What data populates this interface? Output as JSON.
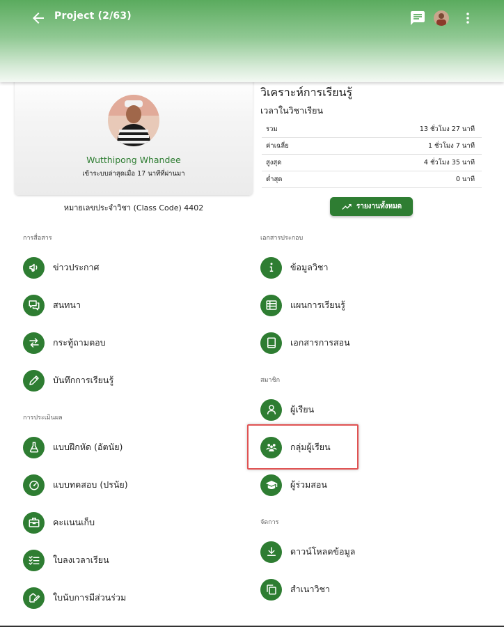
{
  "appbar": {
    "title": "Project (2/63)",
    "back_icon": "arrow-left-icon",
    "chat_icon": "chat-icon",
    "more_icon": "more-vertical-icon"
  },
  "profile": {
    "name": "Wutthipong Whandee",
    "last_login": "เข้าระบบล่าสุดเมื่อ 17 นาทีที่ผ่านมา",
    "class_code": "หมายเลขประจำวิชา (Class Code) 4402"
  },
  "analytics": {
    "title": "วิเคราะห์การเรียนรู้",
    "time_title": "เวลาในวิชาเรียน",
    "rows": [
      {
        "label": "รวม",
        "value": "13 ชั่วโมง 27 นาที"
      },
      {
        "label": "ค่าเฉลี่ย",
        "value": "1 ชั่วโมง 7 นาที"
      },
      {
        "label": "สูงสุด",
        "value": "4 ชั่วโมง 35 นาที"
      },
      {
        "label": "ต่ำสุด",
        "value": "0 นาที"
      }
    ],
    "report_button": "รายงานทั้งหมด"
  },
  "sections": {
    "communication": "การสื่อสาร",
    "assessment": "การประเมินผล",
    "documents": "เอกสารประกอบ",
    "members": "สมาชิก",
    "manage": "จัดการ"
  },
  "menu": {
    "announcements": "ข่าวประกาศ",
    "discussion": "สนทนา",
    "qa": "กระทู้ถามตอบ",
    "learning_log": "บันทึกการเรียนรู้",
    "exercise": "แบบฝึกหัด (อัตนัย)",
    "quiz": "แบบทดสอบ (ปรนัย)",
    "scores": "คะแนนเก็บ",
    "attendance": "ใบลงเวลาเรียน",
    "participation": "ใบนับการมีส่วนร่วม",
    "course_info": "ข้อมูลวิชา",
    "lesson_plan": "แผนการเรียนรู้",
    "teaching_docs": "เอกสารการสอน",
    "students": "ผู้เรียน",
    "student_groups": "กลุ่มผู้เรียน",
    "co_teachers": "ผู้ร่วมสอน",
    "download_data": "ดาวน์โหลดข้อมูล",
    "copy_course": "สำเนาวิชา"
  },
  "colors": {
    "primary_green": "#2e7d32",
    "highlight_red": "#e05252"
  }
}
